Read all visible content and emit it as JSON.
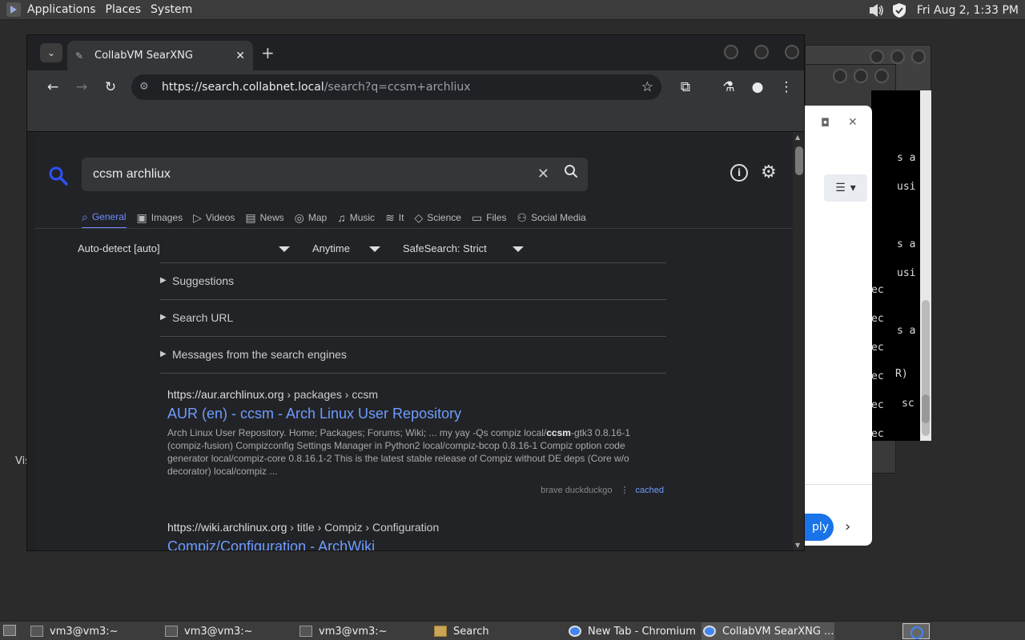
{
  "top_panel": {
    "menus": [
      "Applications",
      "Places",
      "System"
    ],
    "clock": "Fri Aug  2, 1:33 PM"
  },
  "desktop": {
    "partial_label": "Vis"
  },
  "terminal": {
    "lines": [
      "s a",
      "usi",
      "s a",
      "usi",
      "ec",
      "ec",
      "s a",
      "ec",
      "ec",
      "R)",
      "ec",
      "sc",
      "ec"
    ]
  },
  "white_dialog": {
    "apply_label": "ply"
  },
  "browser": {
    "tab_title": "CollabVM SearXNG",
    "url_host": "https://search.collabnet.local",
    "url_path": "/search?q=ccsm+archliux"
  },
  "searx": {
    "query": "ccsm archliux",
    "categories": [
      {
        "label": "General",
        "icon": "search-icon",
        "glyph": "⌕"
      },
      {
        "label": "Images",
        "icon": "image-icon",
        "glyph": "▣"
      },
      {
        "label": "Videos",
        "icon": "video-icon",
        "glyph": "▷"
      },
      {
        "label": "News",
        "icon": "news-icon",
        "glyph": "▤"
      },
      {
        "label": "Map",
        "icon": "map-pin-icon",
        "glyph": "◎"
      },
      {
        "label": "Music",
        "icon": "music-icon",
        "glyph": "♫"
      },
      {
        "label": "It",
        "icon": "layers-icon",
        "glyph": "≋"
      },
      {
        "label": "Science",
        "icon": "science-icon",
        "glyph": "◇"
      },
      {
        "label": "Files",
        "icon": "files-icon",
        "glyph": "▭"
      },
      {
        "label": "Social Media",
        "icon": "people-icon",
        "glyph": "⚇"
      }
    ],
    "filters": {
      "language": "Auto-detect [auto]",
      "time": "Anytime",
      "safesearch": "SafeSearch: Strict"
    },
    "sections": [
      "Suggestions",
      "Search URL",
      "Messages from the search engines"
    ],
    "results": [
      {
        "host": "https://aur.archlinux.org",
        "path": " › packages › ccsm",
        "title": "AUR (en) - ccsm - Arch Linux User Repository",
        "snippet_before": "Arch Linux User Repository. Home; Packages; Forums; Wiki; ... my yay -Qs compiz local/",
        "snippet_bold": "ccsm",
        "snippet_after": "-gtk3 0.8.16-1 (compiz-fusion) Compizconfig Settings Manager in Python2 local/compiz-bcop 0.8.16-1 Compiz option code generator local/compiz-core 0.8.16.1-2 This is the latest stable release of Compiz without DE deps (Core w/o decorator) local/compiz ...",
        "engines": "brave  duckduckgo",
        "cached": "cached"
      },
      {
        "host": "https://wiki.archlinux.org",
        "path": " › title › Compiz › Configuration",
        "title": "Compiz/Configuration - ArchWiki"
      }
    ]
  },
  "taskbar": {
    "items": [
      {
        "label": "vm3@vm3:~",
        "icon": "terminal-icon"
      },
      {
        "label": "vm3@vm3:~",
        "icon": "terminal-icon"
      },
      {
        "label": "vm3@vm3:~",
        "icon": "terminal-icon"
      },
      {
        "label": "Search",
        "icon": "folder-search-icon"
      },
      {
        "label": "New Tab - Chromium",
        "icon": "chromium-icon"
      },
      {
        "label": "CollabVM SearXNG ...",
        "icon": "chromium-icon"
      }
    ]
  }
}
